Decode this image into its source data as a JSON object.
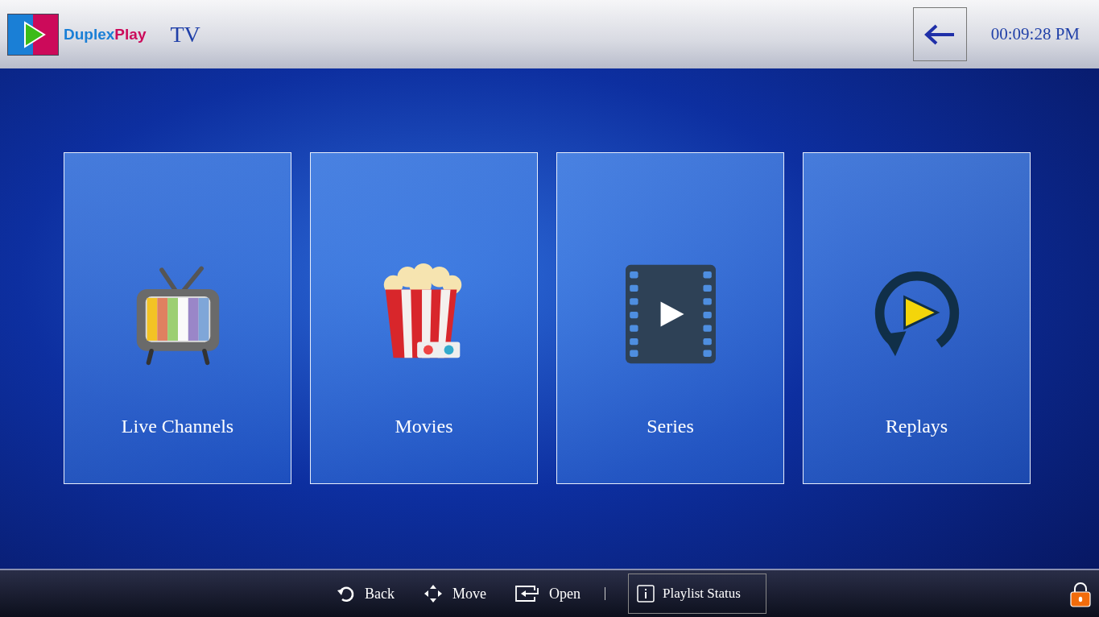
{
  "header": {
    "brand_left": "Duplex",
    "brand_right": "Play",
    "title": "TV",
    "clock": "00:09:28 PM"
  },
  "tiles": [
    {
      "label": "Live Channels",
      "kind": "tv"
    },
    {
      "label": "Movies",
      "kind": "popcorn"
    },
    {
      "label": "Series",
      "kind": "film"
    },
    {
      "label": "Replays",
      "kind": "replay"
    }
  ],
  "footer": {
    "hints": [
      {
        "label": "Back",
        "kind": "back"
      },
      {
        "label": "Move",
        "kind": "move"
      },
      {
        "label": "Open",
        "kind": "open"
      }
    ],
    "status_button": "Playlist Status"
  }
}
